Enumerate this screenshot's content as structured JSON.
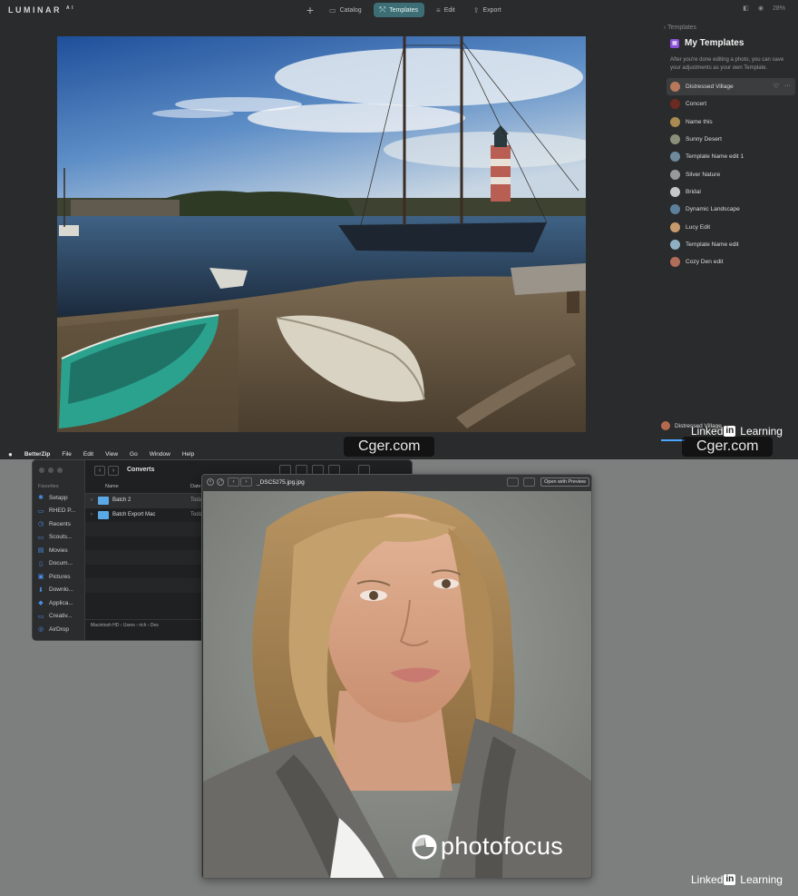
{
  "luminar": {
    "logo": "LUMINAR",
    "logo_suffix": "AI",
    "tabs": [
      {
        "label": "Catalog",
        "icon": "catalog-icon"
      },
      {
        "label": "Templates",
        "icon": "templates-icon",
        "active": true
      },
      {
        "label": "Edit",
        "icon": "edit-icon"
      },
      {
        "label": "Export",
        "icon": "export-icon"
      }
    ],
    "zoom": "28%",
    "panel": {
      "back_label": "Templates",
      "title": "My Templates",
      "description": "After you're done editing a photo, you can save your adjustments as your own Template.",
      "items": [
        {
          "name": "Distressed Village",
          "color": "#b7785c",
          "selected": true
        },
        {
          "name": "Concert",
          "color": "#6b2a22"
        },
        {
          "name": "Name this",
          "color": "#a88a52"
        },
        {
          "name": "Sunny Desert",
          "color": "#8a8f7a"
        },
        {
          "name": "Template Name edit 1",
          "color": "#6e8a9c"
        },
        {
          "name": "Silver Nature",
          "color": "#9a9a9a"
        },
        {
          "name": "Bridal",
          "color": "#c7c7c7"
        },
        {
          "name": "Dynamic Landscape",
          "color": "#5d7f99"
        },
        {
          "name": "Lucy Edit",
          "color": "#c79a6e"
        },
        {
          "name": "Template Name edit",
          "color": "#8fb0c4"
        },
        {
          "name": "Cozy Den edit",
          "color": "#b06e5a"
        }
      ],
      "bottom_label": "Distressed Village"
    }
  },
  "watermarks": {
    "linked": "Linked",
    "in": "in",
    "learning": "Learning",
    "cger": "Cger.com"
  },
  "menubar": {
    "app": "BetterZip",
    "items": [
      "File",
      "Edit",
      "View",
      "Go",
      "Window",
      "Help"
    ]
  },
  "finder": {
    "title": "Converts",
    "favorites_header": "Favorites",
    "favorites": [
      {
        "label": "Setapp",
        "icon": "setapp-icon"
      },
      {
        "label": "RHED P...",
        "icon": "folder-icon"
      },
      {
        "label": "Recents",
        "icon": "clock-icon"
      },
      {
        "label": "Scouts...",
        "icon": "folder-icon"
      },
      {
        "label": "Movies",
        "icon": "film-icon"
      },
      {
        "label": "Docum...",
        "icon": "document-icon"
      },
      {
        "label": "Pictures",
        "icon": "picture-icon"
      },
      {
        "label": "Downlo...",
        "icon": "download-icon"
      },
      {
        "label": "Applica...",
        "icon": "applications-icon"
      },
      {
        "label": "Creativ...",
        "icon": "folder-icon"
      },
      {
        "label": "AirDrop",
        "icon": "airdrop-icon"
      }
    ],
    "columns": {
      "name": "Name",
      "date": "Date"
    },
    "rows": [
      {
        "name": "Batch 2",
        "date": "Toda"
      },
      {
        "name": "Batch Export Mac",
        "date": "Toda"
      }
    ],
    "path": [
      "Macintosh HD",
      "Users",
      "rich",
      "Des"
    ]
  },
  "preview": {
    "filename": "_DSC5275.jpg.jpg",
    "open_with": "Open with Preview",
    "brand": "photofocus"
  }
}
